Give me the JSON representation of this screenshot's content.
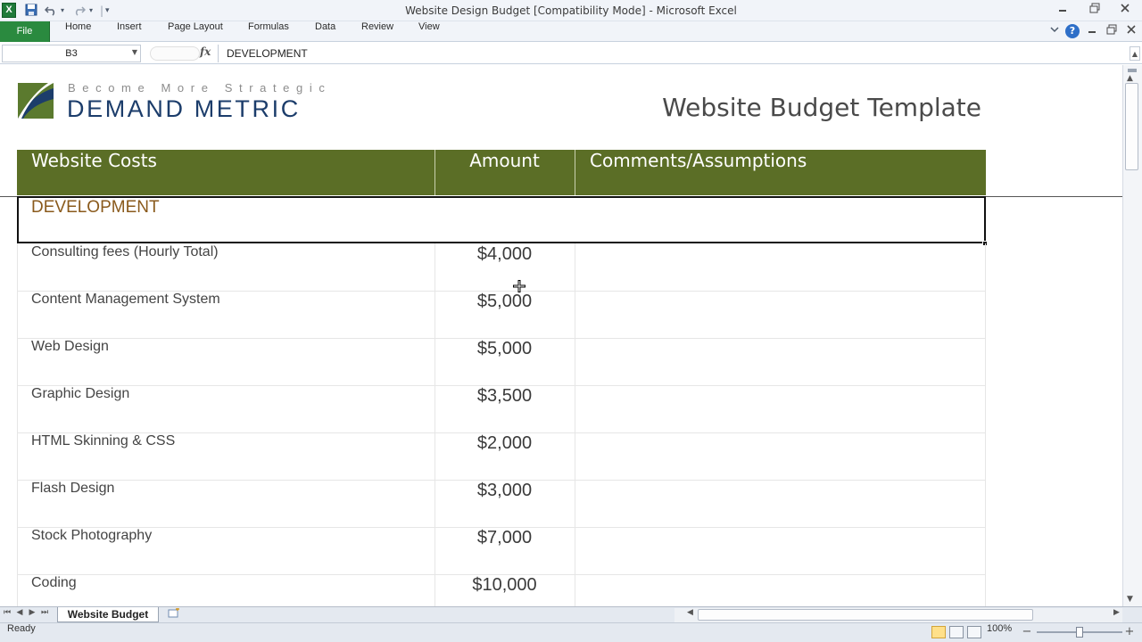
{
  "window": {
    "title": "Website Design Budget  [Compatibility Mode]  -  Microsoft Excel",
    "app_icon": "X"
  },
  "ribbon": {
    "file_label": "File",
    "tabs": [
      "Home",
      "Insert",
      "Page Layout",
      "Formulas",
      "Data",
      "Review",
      "View"
    ]
  },
  "formula_bar": {
    "cell_ref": "B3",
    "fx": "fx",
    "content": "DEVELOPMENT"
  },
  "sheet": {
    "logo_tagline": "Become More Strategic",
    "logo_name": "DEMAND METRIC",
    "title": "Website Budget Template",
    "header": {
      "cost": "Website Costs",
      "amount": "Amount",
      "comments": "Comments/Assumptions"
    },
    "section": "DEVELOPMENT",
    "rows": [
      {
        "cost": "Consulting fees (Hourly Total)",
        "amount": "$4,000",
        "comment": ""
      },
      {
        "cost": "Content Management System",
        "amount": "$5,000",
        "comment": ""
      },
      {
        "cost": "Web Design",
        "amount": "$5,000",
        "comment": ""
      },
      {
        "cost": "Graphic Design",
        "amount": "$3,500",
        "comment": ""
      },
      {
        "cost": "HTML Skinning & CSS",
        "amount": "$2,000",
        "comment": ""
      },
      {
        "cost": "Flash Design",
        "amount": "$3,000",
        "comment": ""
      },
      {
        "cost": "Stock Photography",
        "amount": "$7,000",
        "comment": ""
      },
      {
        "cost": "Coding",
        "amount": "$10,000",
        "comment": ""
      }
    ],
    "header_color": "#5b6e26",
    "section_color": "#8a5a1c"
  },
  "sheet_tabs": {
    "active": "Website Budget"
  },
  "status": {
    "mode": "Ready",
    "zoom": "100%"
  }
}
